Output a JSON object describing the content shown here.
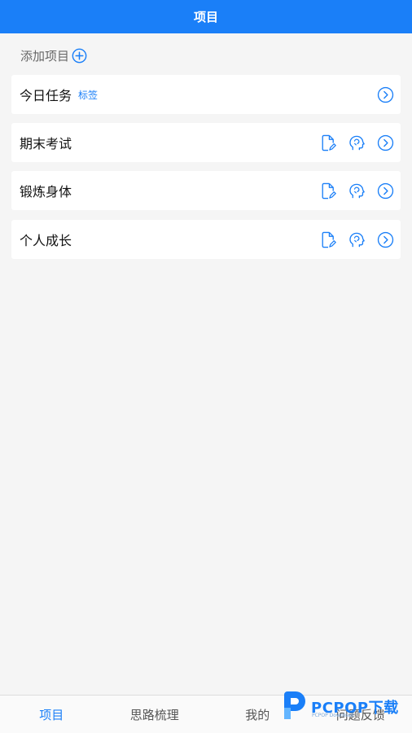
{
  "header": {
    "title": "项目"
  },
  "add_project": {
    "label": "添加项目",
    "icon": "plus-circle-icon"
  },
  "projects": [
    {
      "title": "今日任务",
      "tag": "标签",
      "icons": [
        "chevron-right-circle-icon"
      ]
    },
    {
      "title": "期末考试",
      "icons": [
        "edit-document-icon",
        "mind-icon",
        "chevron-right-circle-icon"
      ]
    },
    {
      "title": "锻炼身体",
      "icons": [
        "edit-document-icon",
        "mind-icon",
        "chevron-right-circle-icon"
      ]
    },
    {
      "title": "个人成长",
      "icons": [
        "edit-document-icon",
        "mind-icon",
        "chevron-right-circle-icon"
      ]
    }
  ],
  "tabs": [
    {
      "label": "项目",
      "active": true
    },
    {
      "label": "思路梳理",
      "active": false
    },
    {
      "label": "我的",
      "active": false
    },
    {
      "label": "问题反馈",
      "active": false
    }
  ],
  "watermark": {
    "text": "PCPOP下载",
    "sub": "PCPOP Download"
  },
  "colors": {
    "accent": "#1a7ff8",
    "background": "#f5f5f5",
    "card": "#ffffff"
  }
}
